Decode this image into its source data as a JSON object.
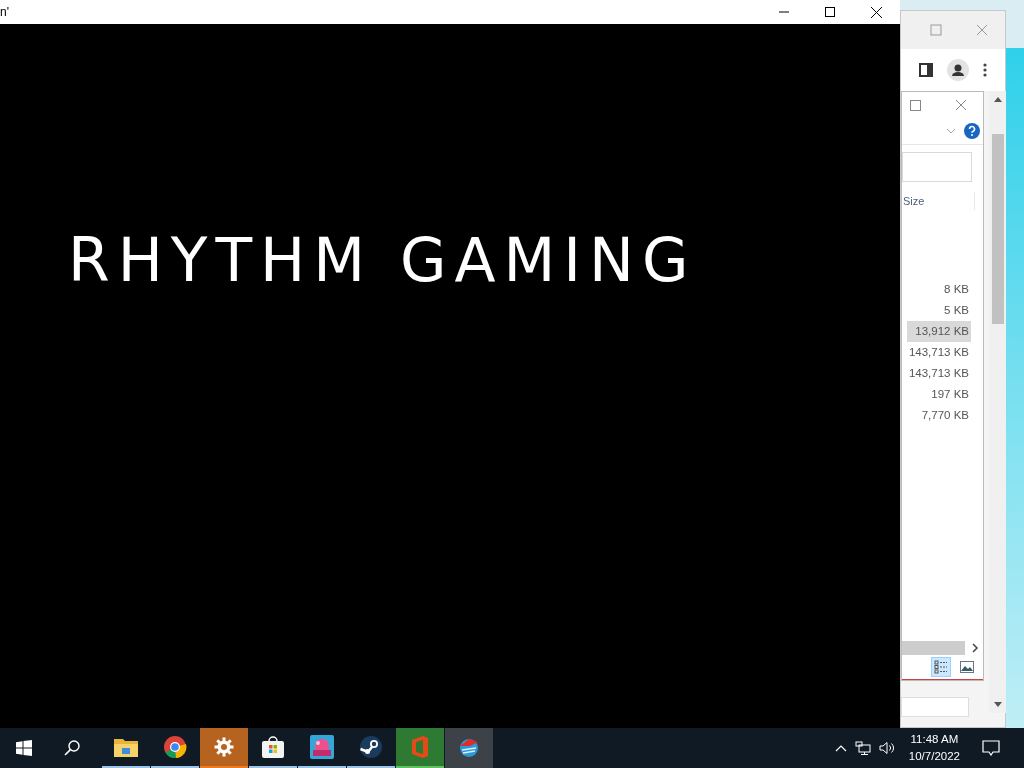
{
  "front_window": {
    "title": "n'",
    "heading": "RHYTHM GAMING"
  },
  "file_dialog": {
    "size_header": "Size",
    "rows": [
      {
        "size": "8 KB",
        "selected": false
      },
      {
        "size": "5 KB",
        "selected": false
      },
      {
        "size": "13,912 KB",
        "selected": true
      },
      {
        "size": "143,713 KB",
        "selected": false
      },
      {
        "size": "143,713 KB",
        "selected": false
      },
      {
        "size": "197 KB",
        "selected": false
      },
      {
        "size": "7,770 KB",
        "selected": false
      }
    ],
    "view_buttons": [
      {
        "kind": "details",
        "selected": true
      },
      {
        "kind": "preview",
        "selected": false
      }
    ]
  },
  "taskbar": {
    "apps": [
      {
        "kind": "folder",
        "running": true
      },
      {
        "kind": "chrome",
        "running": true
      },
      {
        "kind": "gear",
        "running": true,
        "color": "#b5631f"
      },
      {
        "kind": "store",
        "running": true
      },
      {
        "kind": "game",
        "running": true
      },
      {
        "kind": "steam",
        "running": true
      },
      {
        "kind": "office",
        "running": true,
        "color": "#2f7a33"
      },
      {
        "kind": "bird",
        "running": false,
        "color": "#3d4249"
      }
    ],
    "time": "11:48 AM",
    "date": "10/7/2022"
  }
}
